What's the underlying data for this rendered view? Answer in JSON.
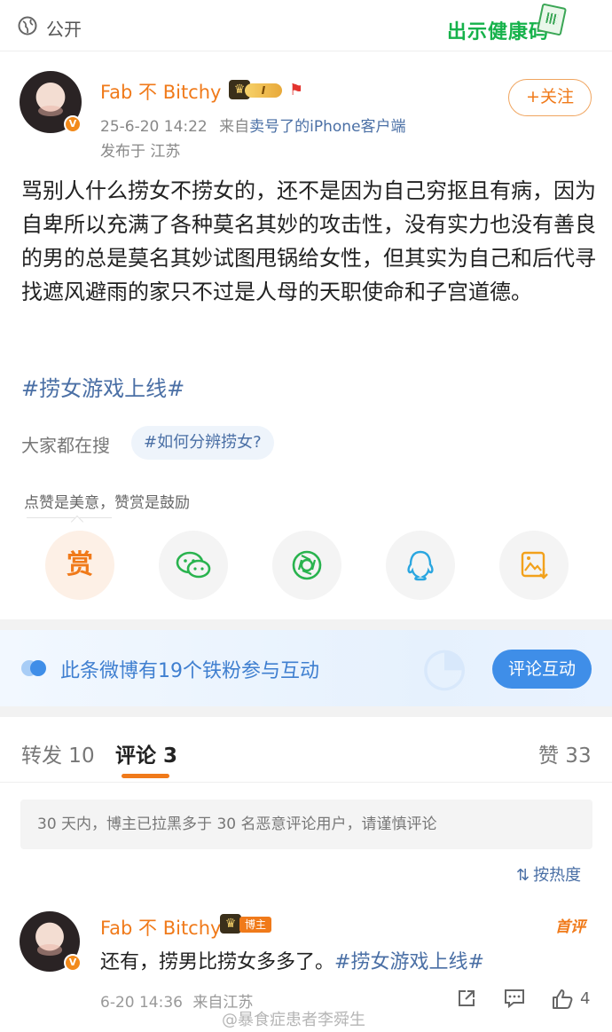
{
  "top": {
    "visibility": "公开",
    "health_code_label": "出示健康码"
  },
  "post": {
    "author": "Fab 不 Bitchy",
    "vip_level": "I",
    "date": "25-6-20 14:22",
    "source_prefix": "来自",
    "source": "卖号了的iPhone客户端",
    "location": "发布于 江苏",
    "follow_label": "+关注",
    "text": "骂别人什么捞女不捞女的，还不是因为自己穷抠且有病，因为自卑所以充满了各种莫名其妙的攻击性，没有实力也没有善良的男的总是莫名其妙试图甩锅给女性，但其实为自己和后代寻找遮风避雨的家只不过是人母的天职使命和子宫道德。",
    "hashtag": "#捞女游戏上线#",
    "search_label": "大家都在搜",
    "search_chip": "#如何分辨捞女?",
    "tip": "点赞是美意，赞赏是鼓励"
  },
  "share": {
    "reward_label": "赏",
    "icons": [
      "reward-icon",
      "wechat-icon",
      "moments-icon",
      "qq-icon",
      "save-image-icon"
    ]
  },
  "fans": {
    "text": "此条微博有19个铁粉参与互动",
    "button": "评论互动"
  },
  "tabs": {
    "repost": "转发 10",
    "comments": "评论 3",
    "likes": "赞 33"
  },
  "notice": "30 天内，博主已拉黑多于 30 名恶意评论用户，请谨慎评论",
  "sort_label": "按热度",
  "comment": {
    "author": "Fab 不 Bitchy",
    "tag": "博主",
    "first_label": "首评",
    "text_plain": "还有，捞男比捞女多多了。",
    "text_hashtag": "#捞女游戏上线#",
    "time": "6-20 14:36",
    "location": "来自江苏",
    "likes": "4"
  },
  "watermark": "@暴食症患者李舜生",
  "colors": {
    "accent": "#f07a1a",
    "link": "#4a6fa5",
    "fans_blue": "#3f8ee8",
    "health_green": "#16b24b"
  }
}
